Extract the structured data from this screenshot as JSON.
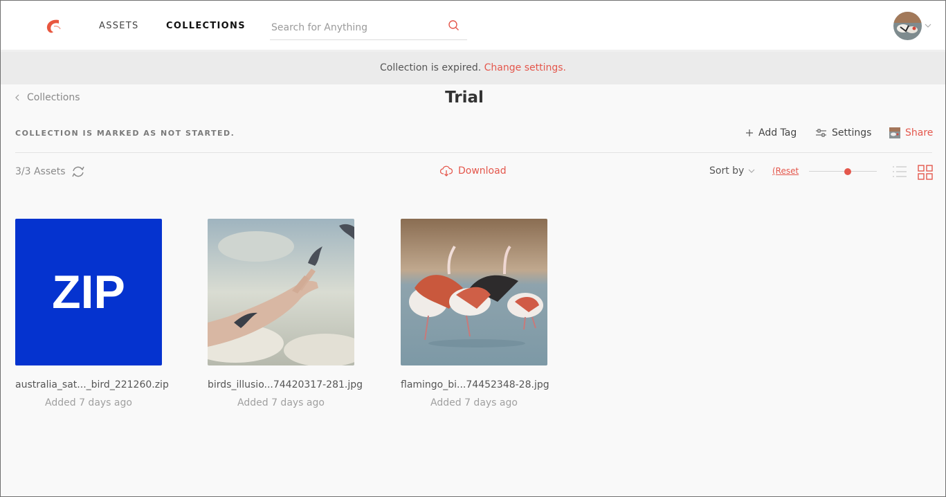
{
  "nav": {
    "assets": "ASSETS",
    "collections": "COLLECTIONS",
    "search_placeholder": "Search for Anything"
  },
  "banner": {
    "text": "Collection is expired.",
    "link": "Change settings."
  },
  "header": {
    "back_label": "Collections",
    "title": "Trial",
    "status": "COLLECTION IS MARKED AS NOT STARTED.",
    "add_tag": "Add Tag",
    "settings": "Settings",
    "share": "Share"
  },
  "toolbar": {
    "count": "3/3 Assets",
    "download": "Download",
    "sort_by": "Sort by",
    "reset": "(Reset",
    "thumbnail_size_fraction": 0.57,
    "active_view": "grid"
  },
  "assets": [
    {
      "name": "australia_sat..._bird_221260.zip",
      "added": "Added 7 days ago",
      "thumb_text": "ZIP"
    },
    {
      "name": "birds_illusio...74420317-281.jpg",
      "added": "Added 7 days ago"
    },
    {
      "name": "flamingo_bi...74452348-28.jpg",
      "added": "Added 7 days ago"
    }
  ],
  "colors": {
    "accent": "#e4574c",
    "zip_blue": "#0533cf",
    "banner_bg": "#ebebeb"
  },
  "icons": [
    "logo-icon",
    "search-icon",
    "chevron-down-icon",
    "chevron-left-icon",
    "plus-icon",
    "sliders-icon",
    "refresh-icon",
    "cloud-download-icon",
    "list-view-icon",
    "grid-view-icon"
  ]
}
